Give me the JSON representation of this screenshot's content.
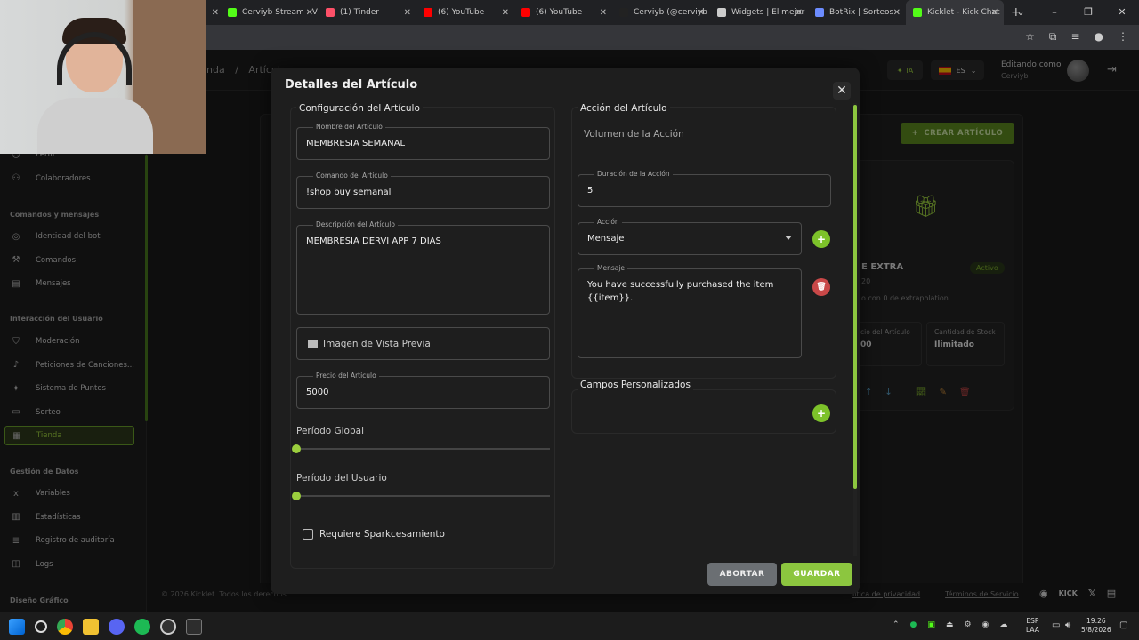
{
  "browser": {
    "tabs": [
      {
        "label": "",
        "color": "#444"
      },
      {
        "label": "Cerviyb Stream - V",
        "color": "#53fc18"
      },
      {
        "label": "(1) Tinder",
        "color": "#fd5068"
      },
      {
        "label": "(6) YouTube",
        "color": "#ff0000"
      },
      {
        "label": "(6) YouTube",
        "color": "#ff0000"
      },
      {
        "label": "Cerviyb (@cerviyb",
        "color": "#222"
      },
      {
        "label": "Widgets | El mejor",
        "color": "#ccc"
      },
      {
        "label": "BotRix | Sorteos",
        "color": "#6c8cff"
      },
      {
        "label": "Kicklet - Kick Chat",
        "color": "#53fc18"
      }
    ]
  },
  "app": {
    "breadcrumb_a": "nda",
    "breadcrumb_sep": "/",
    "breadcrumb_b": "Artículo",
    "ia_label": "IA",
    "lang_label": "ES",
    "editing_as": "Editando como",
    "username": "Cerviyb",
    "sidebar": {
      "items_top": [
        {
          "label": "Perfil",
          "icon": "user-icon"
        },
        {
          "label": "Colaboradores",
          "icon": "users-icon"
        }
      ],
      "section_commands": "Comandos y mensajes",
      "items_commands": [
        {
          "label": "Identidad del bot",
          "icon": "bot-icon"
        },
        {
          "label": "Comandos",
          "icon": "hammer-icon"
        },
        {
          "label": "Mensajes",
          "icon": "messages-icon"
        }
      ],
      "section_interaction": "Interacción del Usuario",
      "items_interaction": [
        {
          "label": "Moderación",
          "icon": "shield-icon"
        },
        {
          "label": "Peticiones de Canciones...",
          "icon": "music-icon"
        },
        {
          "label": "Sistema de Puntos",
          "icon": "star-icon"
        },
        {
          "label": "Sorteo",
          "icon": "ticket-icon"
        },
        {
          "label": "Tienda",
          "icon": "store-icon"
        }
      ],
      "section_data": "Gestión de Datos",
      "items_data": [
        {
          "label": "Variables",
          "icon": "variable-icon"
        },
        {
          "label": "Estadísticas",
          "icon": "chart-icon"
        },
        {
          "label": "Registro de auditoría",
          "icon": "audit-icon"
        },
        {
          "label": "Logs",
          "icon": "logs-icon"
        }
      ],
      "section_design": "Diseño Gráfico"
    },
    "create_button": "CREAR ARTÍCULO",
    "card": {
      "title": "E EXTRA",
      "status": "Activo",
      "subtitle": "20",
      "extra": "o con 0 de extrapolation",
      "stat1_label": "cio del Artículo",
      "stat1_value": "00",
      "stat2_label": "Cantidad de Stock",
      "stat2_value": "Ilimitado"
    },
    "footer": {
      "copyright": "© 2026 Kicklet. Todos los derechos",
      "privacy": "lítica de privacidad",
      "terms": "Términos de Servicio",
      "kick": "KICK"
    }
  },
  "modal": {
    "title": "Detalles del Artículo",
    "close_label": "✕",
    "config_section": "Configuración del Artículo",
    "name_label": "Nombre del Artículo",
    "name_value": "MEMBRESIA SEMANAL",
    "command_label": "Comando del Artículo",
    "command_value": "!shop buy semanal",
    "description_label": "Descripción del Artículo",
    "description_value": "MEMBRESIA DERVI APP 7 DIAS",
    "preview_label": "Imagen de Vista Previa",
    "price_label": "Precio del Artículo",
    "price_value": "5000",
    "global_period_label": "Período Global",
    "global_period_value": 0,
    "user_period_label": "Período del Usuario",
    "user_period_value": 0,
    "requires_label": "Requiere Sparkcesamiento",
    "requires_checked": false,
    "action_section": "Acción del Artículo",
    "action_volume_label": "Volumen de la Acción",
    "duration_label": "Duración de la Acción",
    "duration_value": "5",
    "action_label": "Acción",
    "action_value": "Mensaje",
    "message_label": "Mensaje",
    "message_value": "You have successfully purchased the item {{item}}.",
    "custom_fields_section": "Campos Personalizados",
    "abort_button": "ABORTAR",
    "save_button": "GUARDAR"
  },
  "taskbar": {
    "lang_line1": "ESP",
    "lang_line2": "LAA",
    "time": "19:26",
    "date": "5/8/2026"
  }
}
